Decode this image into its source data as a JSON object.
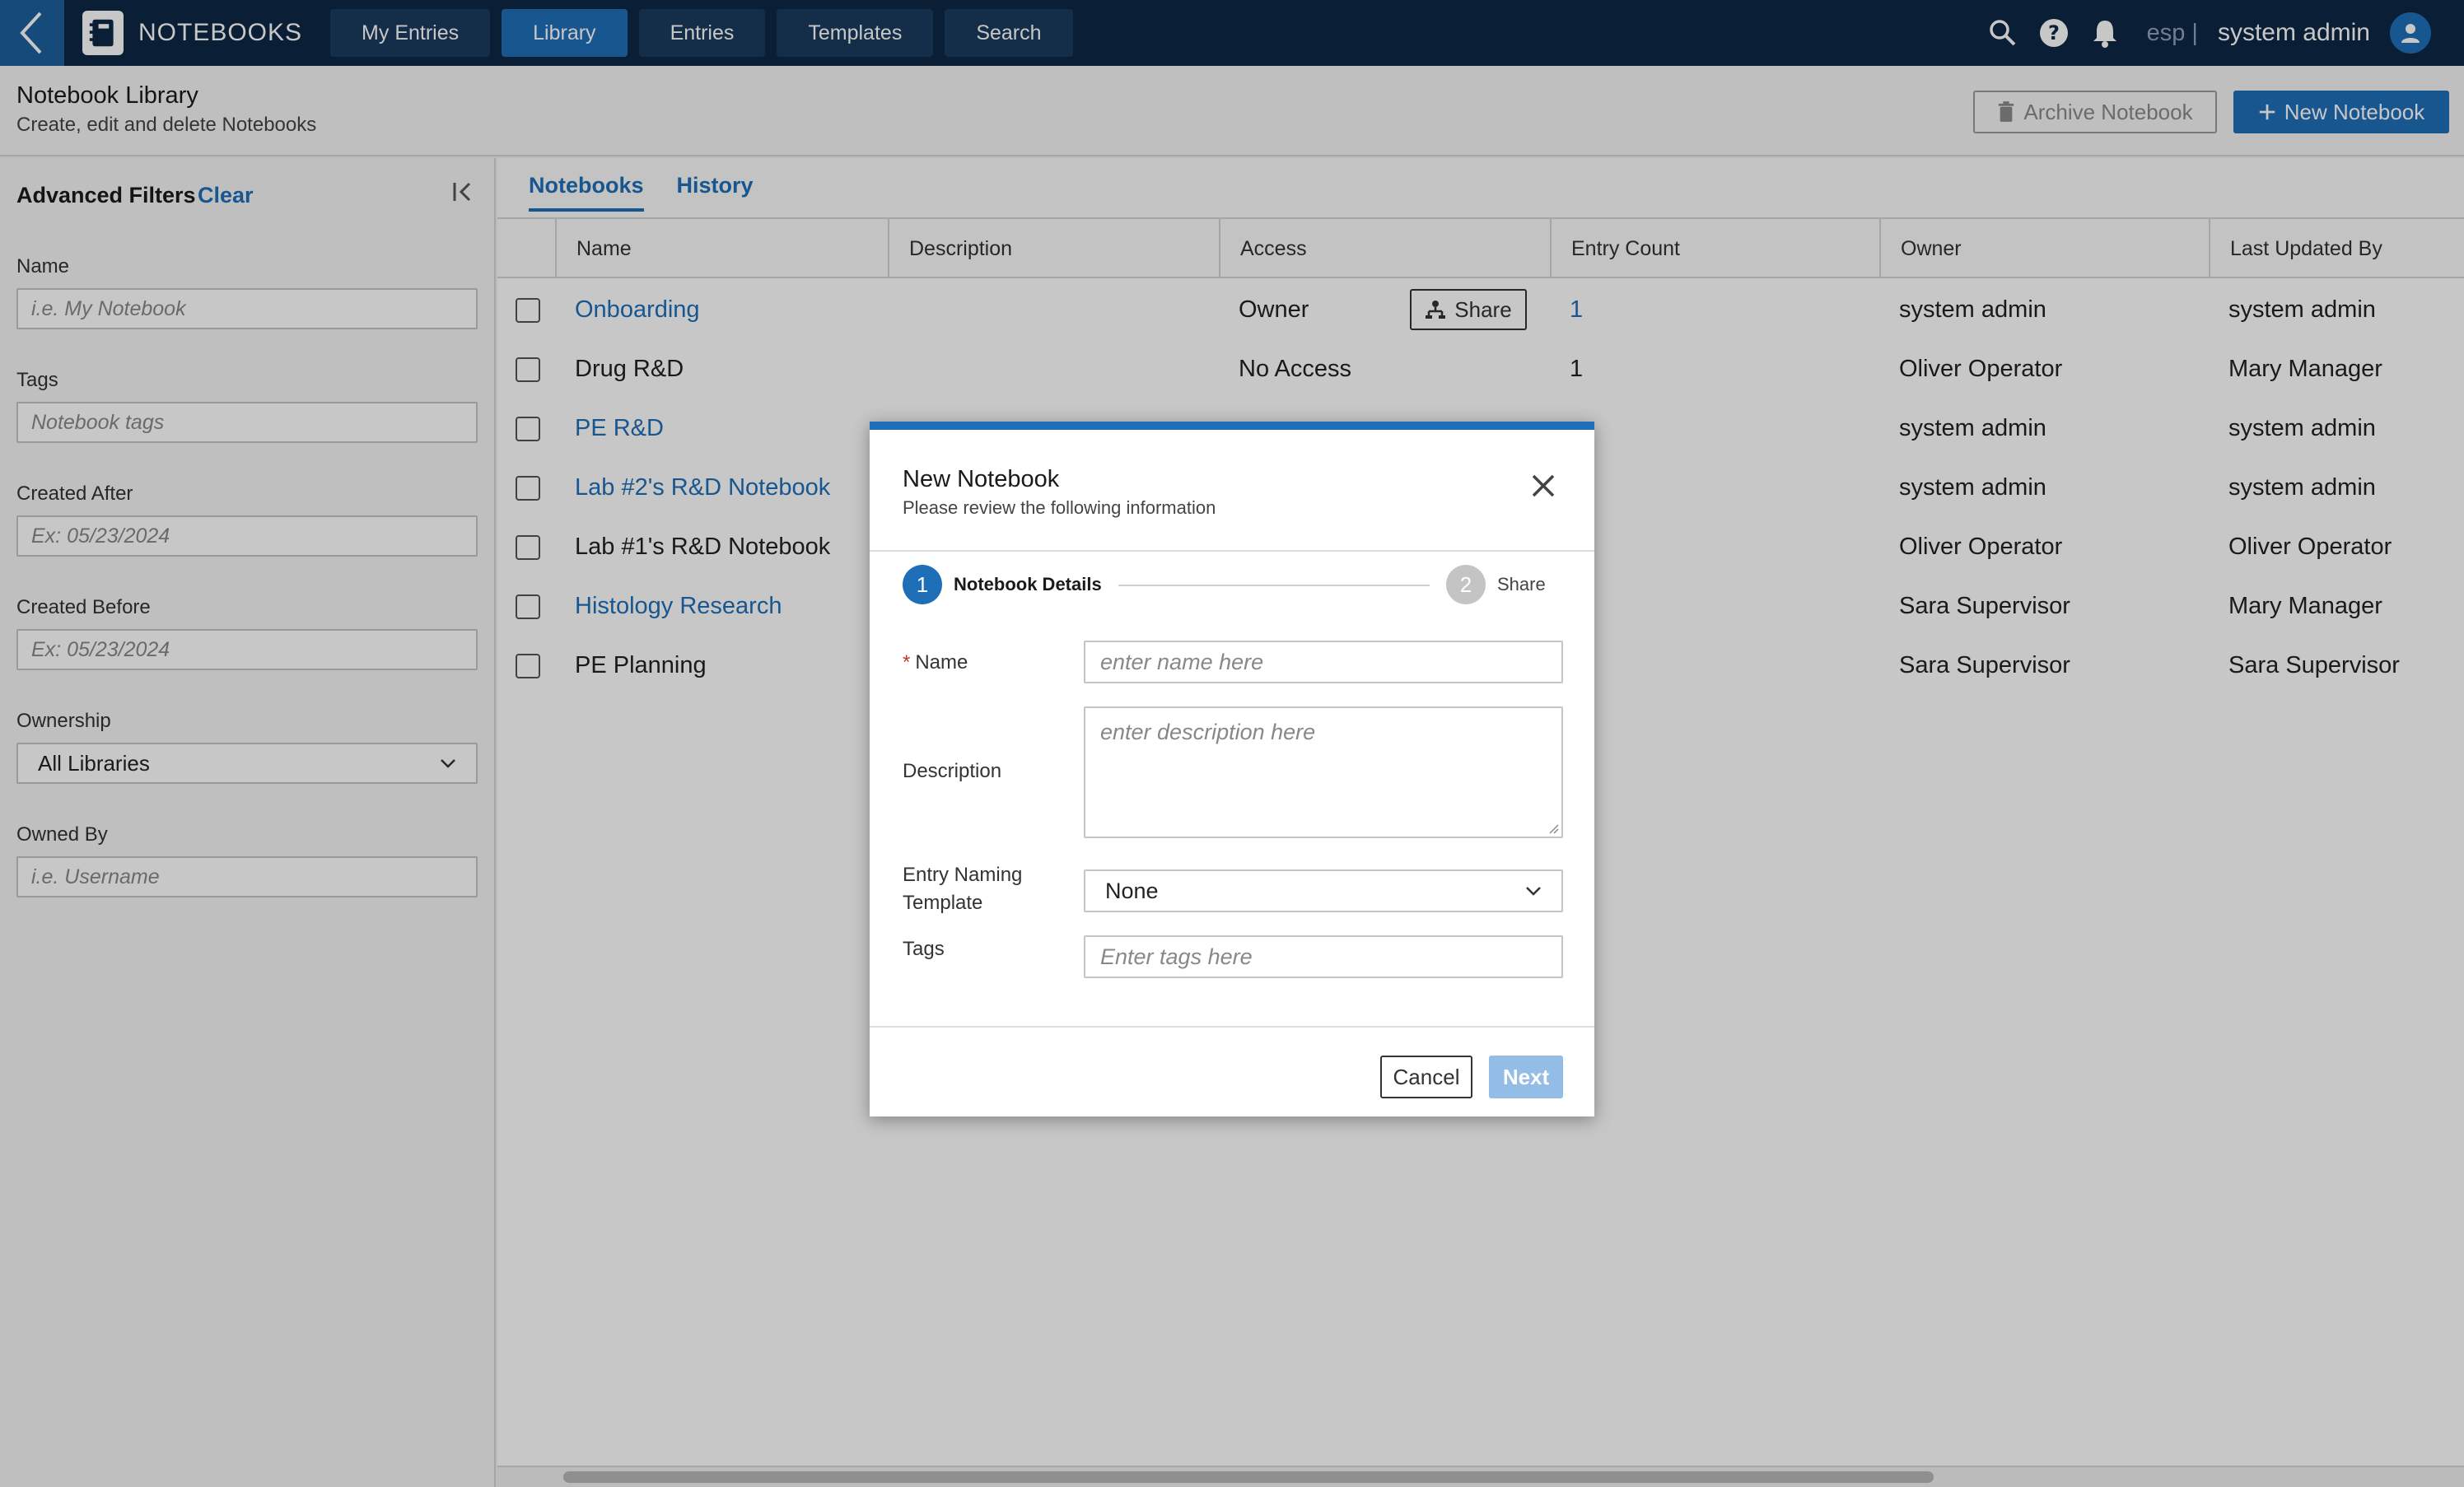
{
  "nav": {
    "app_title": "NOTEBOOKS",
    "tabs": [
      {
        "label": "My Entries"
      },
      {
        "label": "Library"
      },
      {
        "label": "Entries"
      },
      {
        "label": "Templates"
      },
      {
        "label": "Search"
      }
    ],
    "active_tab": "Library",
    "lang": "esp |",
    "user_name": "system admin",
    "icons": [
      "back-chevron-icon",
      "notebook-logo-icon",
      "search-icon",
      "help-icon",
      "bell-icon",
      "user-avatar-icon"
    ]
  },
  "header": {
    "title": "Notebook Library",
    "subtitle": "Create, edit and delete Notebooks",
    "archive_label": "Archive Notebook",
    "new_label": "New Notebook"
  },
  "sidebar": {
    "title": "Advanced Filters",
    "clear_label": "Clear",
    "fields": {
      "name": {
        "label": "Name",
        "placeholder": "i.e. My Notebook"
      },
      "tags": {
        "label": "Tags",
        "placeholder": "Notebook tags"
      },
      "created_after": {
        "label": "Created After",
        "placeholder": "Ex: 05/23/2024"
      },
      "created_before": {
        "label": "Created Before",
        "placeholder": "Ex: 05/23/2024"
      },
      "ownership": {
        "label": "Ownership",
        "value": "All Libraries"
      },
      "owned_by": {
        "label": "Owned By",
        "placeholder": "i.e. Username"
      }
    }
  },
  "main": {
    "tabs": [
      {
        "label": "Notebooks"
      },
      {
        "label": "History"
      }
    ],
    "columns": [
      "Name",
      "Description",
      "Access",
      "Entry Count",
      "Owner",
      "Last Updated By"
    ],
    "share_label": "Share",
    "rows": [
      {
        "name": "Onboarding",
        "link": true,
        "access": "Owner",
        "share": true,
        "entry_count": "1",
        "count_link": true,
        "owner": "system admin",
        "updated_by": "system admin"
      },
      {
        "name": "Drug R&D",
        "link": false,
        "access": "No Access",
        "share": false,
        "entry_count": "1",
        "count_link": false,
        "owner": "Oliver Operator",
        "updated_by": "Mary Manager"
      },
      {
        "name": "PE R&D",
        "link": true,
        "access": "",
        "share": false,
        "entry_count": "",
        "count_link": false,
        "owner": "system admin",
        "updated_by": "system admin"
      },
      {
        "name": "Lab #2's R&D Notebook",
        "link": true,
        "access": "",
        "share": false,
        "entry_count": "",
        "count_link": false,
        "owner": "system admin",
        "updated_by": "system admin"
      },
      {
        "name": "Lab #1's R&D Notebook",
        "link": false,
        "access": "",
        "share": false,
        "entry_count": "",
        "count_link": false,
        "owner": "Oliver Operator",
        "updated_by": "Oliver Operator"
      },
      {
        "name": "Histology Research",
        "link": true,
        "access": "",
        "share": false,
        "entry_count": "",
        "count_link": false,
        "owner": "Sara Supervisor",
        "updated_by": "Mary Manager"
      },
      {
        "name": "PE Planning",
        "link": false,
        "access": "",
        "share": false,
        "entry_count": "",
        "count_link": false,
        "owner": "Sara Supervisor",
        "updated_by": "Sara Supervisor"
      }
    ]
  },
  "modal": {
    "title": "New Notebook",
    "subtitle": "Please review the following information",
    "steps": [
      {
        "num": "1",
        "label": "Notebook Details",
        "active": true
      },
      {
        "num": "2",
        "label": "Share",
        "active": false
      }
    ],
    "fields": {
      "name": {
        "required_mark": "*",
        "label": "Name",
        "placeholder": "enter name here"
      },
      "description": {
        "label": "Description",
        "placeholder": "enter description here"
      },
      "template": {
        "label_line1": "Entry Naming",
        "label_line2": "Template",
        "value": "None"
      },
      "tags": {
        "label": "Tags",
        "placeholder": "Enter tags here"
      }
    },
    "cancel_label": "Cancel",
    "next_label": "Next"
  },
  "colors": {
    "nav_bg": "#0d2744",
    "accent": "#1f6fb8",
    "disabled_accent": "#93bce6",
    "required": "#c0392b"
  }
}
